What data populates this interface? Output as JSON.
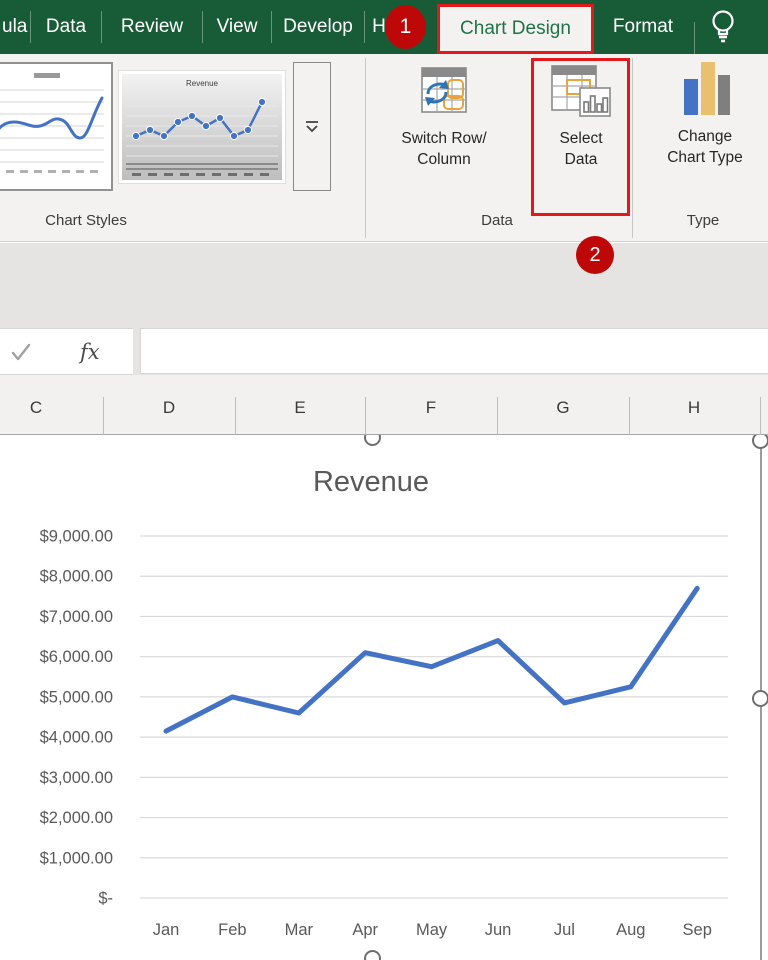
{
  "tab_bar": {
    "tabs": [
      {
        "label": "ula"
      },
      {
        "label": "Data"
      },
      {
        "label": "Review"
      },
      {
        "label": "View"
      },
      {
        "label": "Develop"
      },
      {
        "label": "H"
      }
    ],
    "active_tab": {
      "label": "Chart Design"
    },
    "format_tab": {
      "label": "Format"
    }
  },
  "annotations": {
    "step1": "1",
    "step2": "2"
  },
  "ribbon": {
    "chart_styles": {
      "group_label": "Chart Styles",
      "style2_title": "Revenue"
    },
    "data_group": {
      "group_label": "Data",
      "switch_button_line1": "Switch Row/",
      "switch_button_line2": "Column",
      "select_button_line1": "Select",
      "select_button_line2": "Data"
    },
    "type_group": {
      "group_label": "Type",
      "change_button_line1": "Change",
      "change_button_line2": "Chart Type"
    }
  },
  "formula_bar": {
    "fx_label": "fx",
    "value": ""
  },
  "columns": [
    "C",
    "D",
    "E",
    "F",
    "G",
    "H"
  ],
  "icons": {
    "tell_me": "lightbulb-icon",
    "gallery_more": "more-dropdown-icon",
    "formula_confirm": "checkmark-icon",
    "switch_row_column": "table-swap-arrows-icon",
    "select_data": "table-mini-chart-icon",
    "change_chart_type": "column-bars-icon"
  },
  "colors": {
    "ribbon_green": "#185C37",
    "active_tab_text": "#217346",
    "annotation_red": "#BE0808",
    "annotation_box_red": "#E1191C",
    "series_blue": "#4472C4",
    "gridline": "#D9D9D9",
    "axis_text": "#595959"
  },
  "chart_data": {
    "type": "line",
    "title": "Revenue",
    "categories": [
      "Jan",
      "Feb",
      "Mar",
      "Apr",
      "May",
      "Jun",
      "Jul",
      "Aug",
      "Sep"
    ],
    "values": [
      4150,
      5000,
      4600,
      6100,
      5750,
      6400,
      4850,
      5250,
      7700
    ],
    "series": [
      {
        "name": "Revenue",
        "values": [
          4150,
          5000,
          4600,
          6100,
          5750,
          6400,
          4850,
          5250,
          7700
        ]
      }
    ],
    "ytick_labels": [
      "$9,000.00",
      "$8,000.00",
      "$7,000.00",
      "$6,000.00",
      "$5,000.00",
      "$4,000.00",
      "$3,000.00",
      "$2,000.00",
      "$1,000.00",
      "$-"
    ],
    "ylim": [
      0,
      9000
    ],
    "ytick_step": 1000,
    "xlabel": "",
    "ylabel": "",
    "grid": true,
    "legend": "none",
    "series_color": "#4472C4"
  }
}
